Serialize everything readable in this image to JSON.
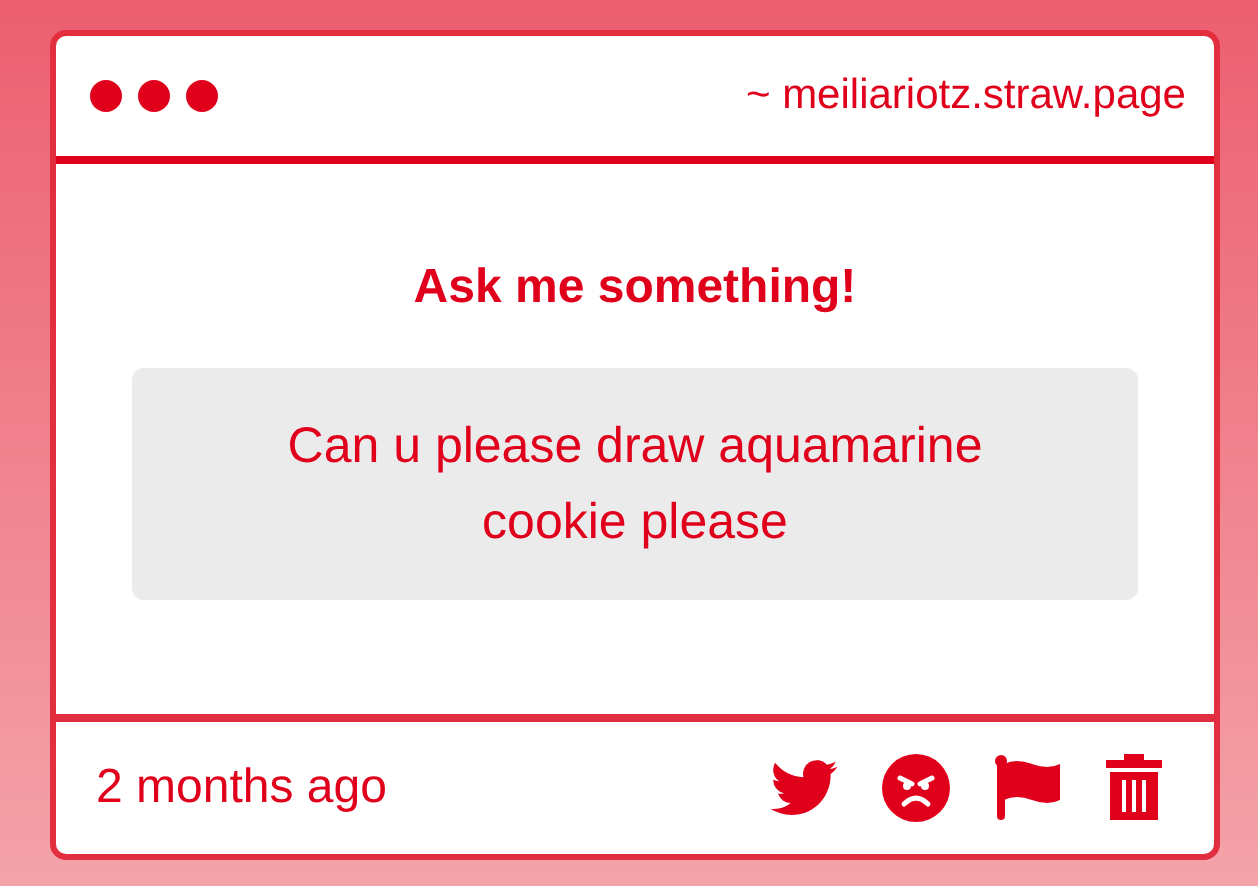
{
  "header": {
    "url": "~ meiliariotz.straw.page"
  },
  "title": "Ask me something!",
  "question": "Can u please draw aquamarine cookie please",
  "footer": {
    "time": "2 months ago"
  }
}
